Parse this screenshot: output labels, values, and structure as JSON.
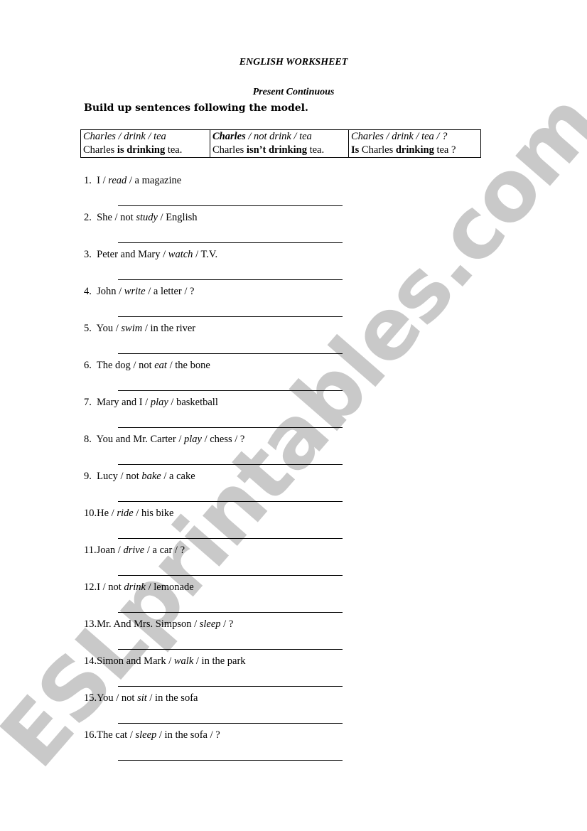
{
  "watermark": "ESLprintables.com",
  "header": {
    "title": "ENGLISH WORKSHEET",
    "subtitle": "Present Continuous",
    "instruction": "Build up sentences following the model."
  },
  "model_table": [
    {
      "prompt": [
        {
          "t": "Charles / drink / tea",
          "s": "i"
        }
      ],
      "answer": [
        {
          "t": "Charles ",
          "s": ""
        },
        {
          "t": "is drinking",
          "s": "b"
        },
        {
          "t": " tea.",
          "s": ""
        }
      ]
    },
    {
      "prompt": [
        {
          "t": "Charles",
          "s": "bi"
        },
        {
          "t": " / not drink / tea",
          "s": "i"
        }
      ],
      "answer": [
        {
          "t": "Charles ",
          "s": ""
        },
        {
          "t": "isn’t drinking",
          "s": "b"
        },
        {
          "t": " tea.",
          "s": ""
        }
      ]
    },
    {
      "prompt": [
        {
          "t": "Charles / drink / tea / ?",
          "s": "i"
        }
      ],
      "answer": [
        {
          "t": "Is",
          "s": "b"
        },
        {
          "t": " Charles ",
          "s": ""
        },
        {
          "t": "drinking",
          "s": "b"
        },
        {
          "t": " tea ?",
          "s": ""
        }
      ]
    }
  ],
  "exercises": [
    {
      "num": "1.  ",
      "parts": [
        {
          "t": "I / ",
          "s": ""
        },
        {
          "t": "read",
          "s": "i"
        },
        {
          "t": " / a magazine",
          "s": ""
        }
      ],
      "answer": ""
    },
    {
      "num": "2.  ",
      "parts": [
        {
          "t": "She / not ",
          "s": ""
        },
        {
          "t": "study",
          "s": "i"
        },
        {
          "t": " / English",
          "s": ""
        }
      ],
      "answer": ""
    },
    {
      "num": "3.  ",
      "parts": [
        {
          "t": "Peter and Mary / ",
          "s": ""
        },
        {
          "t": "watch",
          "s": "i"
        },
        {
          "t": " / T.V.",
          "s": ""
        }
      ],
      "answer": ""
    },
    {
      "num": "4.  ",
      "parts": [
        {
          "t": "John / ",
          "s": ""
        },
        {
          "t": "write",
          "s": "i"
        },
        {
          "t": " / a letter / ?",
          "s": ""
        }
      ],
      "answer": ""
    },
    {
      "num": "5.  ",
      "parts": [
        {
          "t": "You / ",
          "s": ""
        },
        {
          "t": "swim",
          "s": "i"
        },
        {
          "t": " / in the river",
          "s": ""
        }
      ],
      "answer": ""
    },
    {
      "num": "6.  ",
      "parts": [
        {
          "t": "The dog / not ",
          "s": ""
        },
        {
          "t": "eat",
          "s": "i"
        },
        {
          "t": " / the bone",
          "s": ""
        }
      ],
      "answer": ""
    },
    {
      "num": "7.  ",
      "parts": [
        {
          "t": "Mary and I / ",
          "s": ""
        },
        {
          "t": "play",
          "s": "i"
        },
        {
          "t": " / basketball",
          "s": ""
        }
      ],
      "answer": ""
    },
    {
      "num": "8.  ",
      "parts": [
        {
          "t": "You and Mr. Carter / ",
          "s": ""
        },
        {
          "t": "play",
          "s": "i"
        },
        {
          "t": " / chess / ?",
          "s": ""
        }
      ],
      "answer": ""
    },
    {
      "num": "9.  ",
      "parts": [
        {
          "t": "Lucy / not ",
          "s": ""
        },
        {
          "t": "bake",
          "s": "i"
        },
        {
          "t": " / a cake",
          "s": ""
        }
      ],
      "answer": ""
    },
    {
      "num": "10.",
      "parts": [
        {
          "t": "He / ",
          "s": ""
        },
        {
          "t": "ride",
          "s": "i"
        },
        {
          "t": " / his bike",
          "s": ""
        }
      ],
      "answer": ""
    },
    {
      "num": "11.",
      "parts": [
        {
          "t": "Joan / ",
          "s": ""
        },
        {
          "t": "drive",
          "s": "i"
        },
        {
          "t": " / a car / ?",
          "s": ""
        }
      ],
      "answer": ""
    },
    {
      "num": "12.",
      "parts": [
        {
          "t": "I / not ",
          "s": ""
        },
        {
          "t": "drink",
          "s": "i"
        },
        {
          "t": " / lemonade",
          "s": ""
        }
      ],
      "answer": ""
    },
    {
      "num": "13.",
      "parts": [
        {
          "t": "Mr. And Mrs. Simpson / ",
          "s": ""
        },
        {
          "t": "sleep",
          "s": "i"
        },
        {
          "t": " / ?",
          "s": ""
        }
      ],
      "answer": ""
    },
    {
      "num": "14.",
      "parts": [
        {
          "t": "Simon and Mark / ",
          "s": ""
        },
        {
          "t": "walk",
          "s": "i"
        },
        {
          "t": " / in the park",
          "s": ""
        }
      ],
      "answer": ""
    },
    {
      "num": "15.",
      "parts": [
        {
          "t": "You / not ",
          "s": ""
        },
        {
          "t": "sit",
          "s": "i"
        },
        {
          "t": " / in the sofa",
          "s": ""
        }
      ],
      "answer": ""
    },
    {
      "num": "16.",
      "parts": [
        {
          "t": "The cat / ",
          "s": ""
        },
        {
          "t": "sleep",
          "s": "i"
        },
        {
          "t": " / in the sofa / ?",
          "s": ""
        }
      ],
      "answer": ""
    }
  ]
}
